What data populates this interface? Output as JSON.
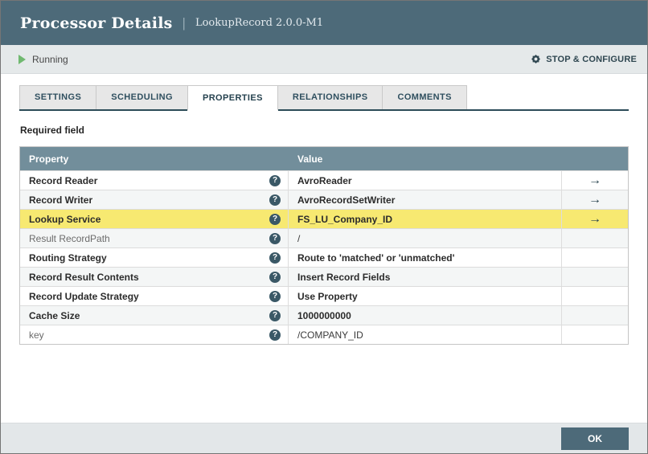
{
  "colors": {
    "header_bg": "#4d6a79",
    "table_header_bg": "#728e9b",
    "highlight_row": "#f7e971",
    "running_green": "#70b970",
    "tab_underline": "#2c4c58"
  },
  "header": {
    "title": "Processor Details",
    "separator": "|",
    "subtitle": "LookupRecord 2.0.0-M1"
  },
  "status_bar": {
    "state_label": "Running",
    "action_label": "STOP & CONFIGURE"
  },
  "tabs": [
    {
      "label": "SETTINGS",
      "active": false
    },
    {
      "label": "SCHEDULING",
      "active": false
    },
    {
      "label": "PROPERTIES",
      "active": true
    },
    {
      "label": "RELATIONSHIPS",
      "active": false
    },
    {
      "label": "COMMENTS",
      "active": false
    }
  ],
  "required_field_label": "Required field",
  "icons": {
    "help": "?",
    "goto": "→"
  },
  "properties_table": {
    "columns": [
      "Property",
      "Value"
    ],
    "rows": [
      {
        "property": "Record Reader",
        "value": "AvroReader",
        "required": true,
        "value_bold": true,
        "has_goto": true,
        "highlighted": false
      },
      {
        "property": "Record Writer",
        "value": "AvroRecordSetWriter",
        "required": true,
        "value_bold": true,
        "has_goto": true,
        "highlighted": false
      },
      {
        "property": "Lookup Service",
        "value": "FS_LU_Company_ID",
        "required": true,
        "value_bold": true,
        "has_goto": true,
        "highlighted": true
      },
      {
        "property": "Result RecordPath",
        "value": "/",
        "required": false,
        "value_bold": false,
        "has_goto": false,
        "highlighted": false
      },
      {
        "property": "Routing Strategy",
        "value": "Route to 'matched' or 'unmatched'",
        "required": true,
        "value_bold": true,
        "has_goto": false,
        "highlighted": false
      },
      {
        "property": "Record Result Contents",
        "value": "Insert Record Fields",
        "required": true,
        "value_bold": true,
        "has_goto": false,
        "highlighted": false
      },
      {
        "property": "Record Update Strategy",
        "value": "Use Property",
        "required": true,
        "value_bold": true,
        "has_goto": false,
        "highlighted": false
      },
      {
        "property": "Cache Size",
        "value": "1000000000",
        "required": true,
        "value_bold": true,
        "has_goto": false,
        "highlighted": false
      },
      {
        "property": "key",
        "value": "/COMPANY_ID",
        "required": false,
        "value_bold": false,
        "has_goto": false,
        "highlighted": false
      }
    ]
  },
  "footer": {
    "ok_label": "OK"
  }
}
